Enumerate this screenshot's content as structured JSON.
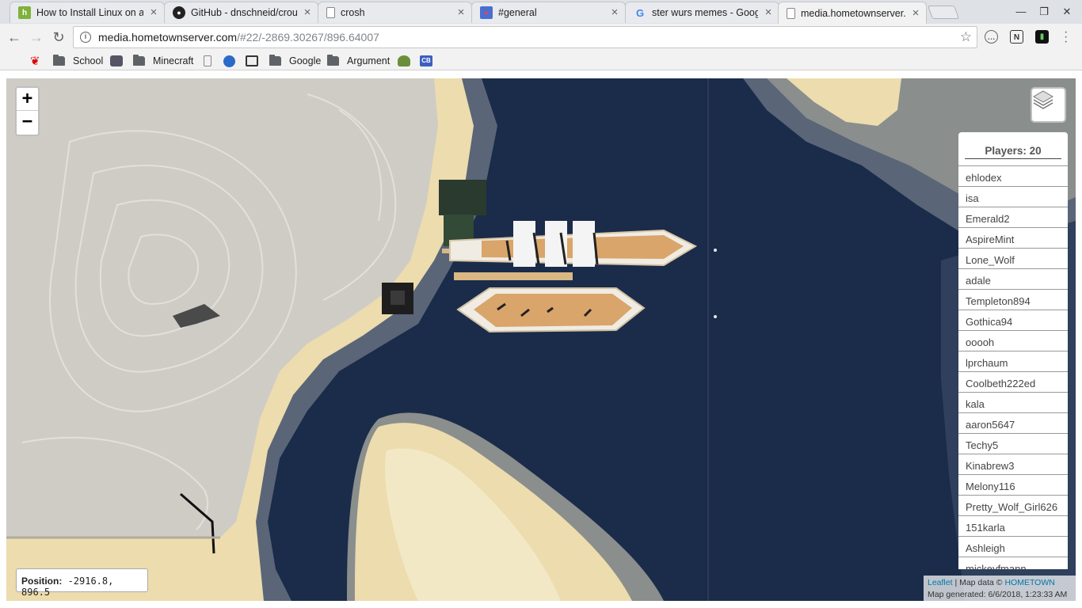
{
  "tabs": [
    {
      "title": "How to Install Linux on a",
      "icon": "hostinger-icon",
      "color": "#7eb23a",
      "glyph": "h"
    },
    {
      "title": "GitHub - dnschneid/crout",
      "icon": "github-icon",
      "color": "#222222",
      "glyph": "●"
    },
    {
      "title": "crosh",
      "icon": "page-icon",
      "color": "#ffffff",
      "glyph": ""
    },
    {
      "title": "#general",
      "icon": "chat-icon",
      "color": "#ed4245",
      "glyph": "●"
    },
    {
      "title": "ster wurs memes - Googl",
      "icon": "google-icon",
      "color": "#ffffff",
      "glyph": "G"
    },
    {
      "title": "media.hometownserver.c",
      "icon": "page-icon",
      "color": "#ffffff",
      "glyph": ""
    }
  ],
  "omnibox": {
    "host": "media.hometownserver.com",
    "path": "/#22/-2869.30267/896.64007"
  },
  "bookmarks": [
    {
      "label": "",
      "icon": "maple-leaf-icon"
    },
    {
      "label": "School",
      "icon": "folder-icon"
    },
    {
      "label": "",
      "icon": "c-icon"
    },
    {
      "label": "Minecraft",
      "icon": "folder-icon"
    },
    {
      "label": "",
      "icon": "page-icon"
    },
    {
      "label": "",
      "icon": "globe-icon"
    },
    {
      "label": "",
      "icon": "building-icon"
    },
    {
      "label": "Google",
      "icon": "folder-icon"
    },
    {
      "label": "Argument",
      "icon": "folder-icon"
    },
    {
      "label": "",
      "icon": "turtle-icon"
    },
    {
      "label": "",
      "icon": "cb-icon"
    }
  ],
  "map": {
    "zoom_in": "+",
    "zoom_out": "−",
    "players_title": "Players: 20",
    "players": [
      "ehlodex",
      "isa",
      "Emerald2",
      "AspireMint",
      "Lone_Wolf",
      "adale",
      "Templeton894",
      "Gothica94",
      "ooooh",
      "lprchaum",
      "Coolbeth222ed",
      "kala",
      "aaron5647",
      "Techy5",
      "Kinabrew3",
      "Melony116",
      "Pretty_Wolf_Girl626",
      "151karla",
      "Ashleigh",
      "mickeyfmann"
    ],
    "position_label": "Position:",
    "position_value": "-2916.8, 896.5",
    "attribution": {
      "leaflet": "Leaflet",
      "sep": " | Map data © ",
      "hometown": "HOMETOWN",
      "generated": "Map generated: 6/6/2018, 1:23:33 AM"
    },
    "colors": {
      "deep_water": "#1b2b4a",
      "water": "#26385a",
      "shallow": "#5a6577",
      "sand": "#ecdcae",
      "snow": "#cfccc6"
    }
  }
}
